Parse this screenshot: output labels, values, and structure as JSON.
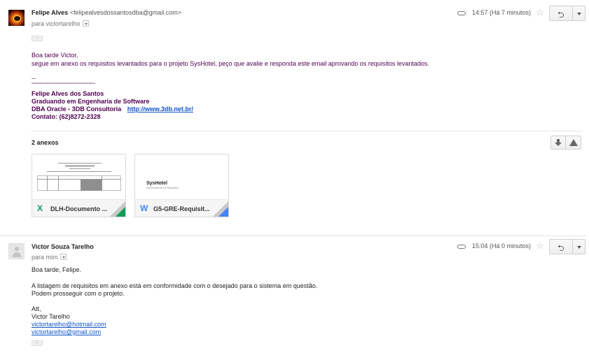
{
  "message1": {
    "sender_name": "Felipe Alves",
    "sender_email": "<felipealvesdossantosdba@gmail.com>",
    "to_line": "para victortarelho",
    "time": "14:57 (Há 7 minutos)",
    "ellipsis": "...",
    "body": {
      "greeting": "Boa tarde Victor,",
      "line1": "segue em anexo os requisitos levantados para o projeto SysHotel, peço que avalie e responda este email aprovando os requisitos levantados.",
      "sig_dash": "--",
      "sig_rule": "---------------------------------------",
      "sig_name": "Felipe Alves dos Santos",
      "sig_course": "Graduando em Engenharia de Software",
      "sig_company": "DBA Oracle - 3DB Consultoria",
      "sig_url": "http://www.3db.net.br/",
      "sig_contact": "Contato: (62)8272-2328"
    },
    "attachments_title": "2 anexos",
    "attachments": [
      {
        "name": "DLH-Documento ...",
        "type_letter": "X",
        "color": "#0f9d58"
      },
      {
        "name": "G5-GRE-Requisit...",
        "type_letter": "W",
        "color": "#4285f4",
        "thumb_title": "SysHotel",
        "thumb_sub": "Gerenciamento de Requisitos"
      }
    ]
  },
  "message2": {
    "sender_name": "Victor Souza Tarelho",
    "to_line": "para mim",
    "time": "15:04 (Há 0 minutos)",
    "ellipsis": "...",
    "body": {
      "greeting": "Boa tarde, Felipe.",
      "line1": "A listagem de requisitos em anexo está em conformidade com o desejado para o sistema em questão.",
      "line2": "Podem prosseguir com o projeto.",
      "closing": "Att,",
      "name": "Victor Tarelho",
      "email1": "victortarelho@hotmail.com",
      "email2": "victortarelho@gmail.com"
    }
  },
  "icons": [
    "paperclip-icon",
    "star-icon",
    "reply-icon",
    "more-options-icon",
    "download-icon",
    "drive-icon",
    "excel-file-icon",
    "word-file-icon"
  ]
}
